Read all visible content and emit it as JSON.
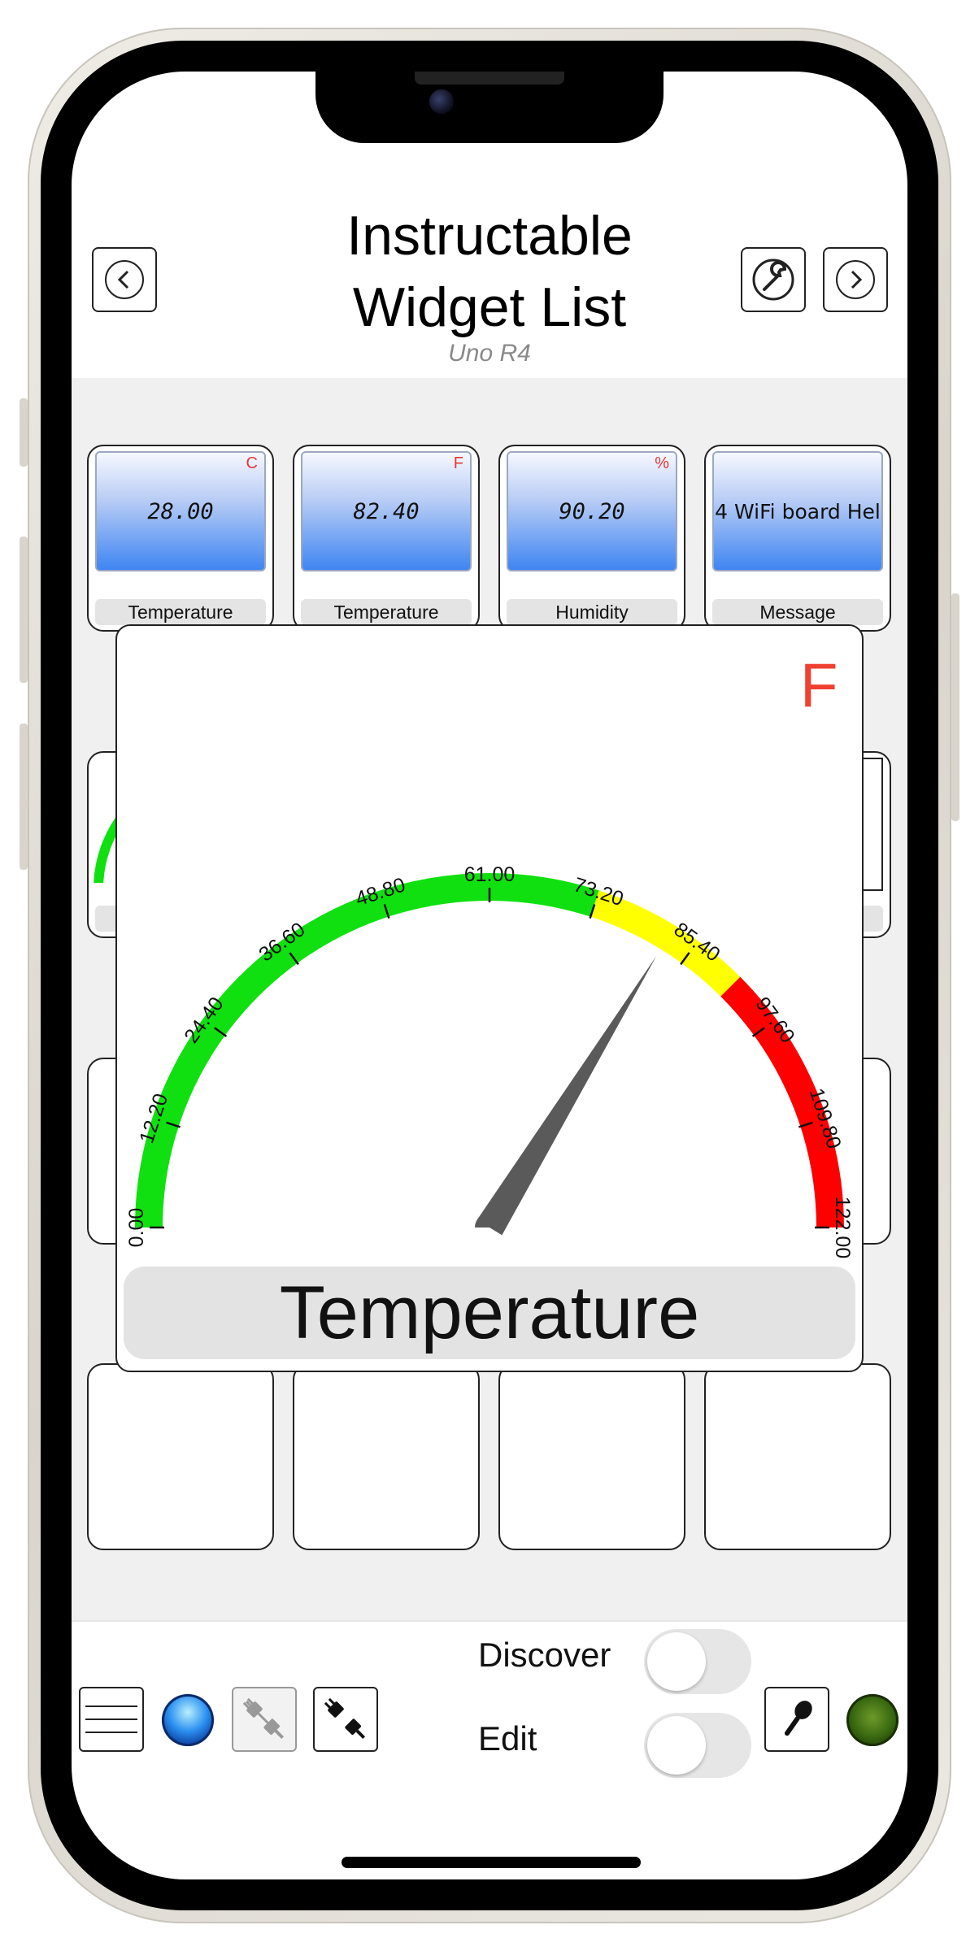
{
  "header": {
    "title_line1": "Instructable",
    "title_line2": "Widget List",
    "subtitle": "Uno R4"
  },
  "widgets": [
    {
      "value": "28.00",
      "unit": "C",
      "label": "Temperature"
    },
    {
      "value": "82.40",
      "unit": "F",
      "label": "Temperature"
    },
    {
      "value": "90.20",
      "unit": "%",
      "label": "Humidity"
    },
    {
      "value": "4 WiFi board Hel",
      "unit": "",
      "label": "Message"
    }
  ],
  "modal": {
    "unit": "F",
    "label": "Temperature",
    "gauge": {
      "min": 0,
      "max": 122,
      "value": 82.4,
      "ticks": [
        "0.00",
        "12.20",
        "24.40",
        "36.60",
        "48.80",
        "61.00",
        "73.20",
        "85.40",
        "97.60",
        "109.80",
        "122.00"
      ],
      "zones": [
        {
          "from": 0,
          "to": 73.2,
          "color": "#10e010"
        },
        {
          "from": 73.2,
          "to": 91.5,
          "color": "#ffff00"
        },
        {
          "from": 91.5,
          "to": 122,
          "color": "#ff0000"
        }
      ]
    }
  },
  "bottom": {
    "discover_label": "Discover",
    "edit_label": "Edit",
    "discover_on": false,
    "edit_on": false
  },
  "colors": {
    "status_blue": "#2a8ff0",
    "status_green": "#3a6a10",
    "unit_red": "#e53935"
  }
}
